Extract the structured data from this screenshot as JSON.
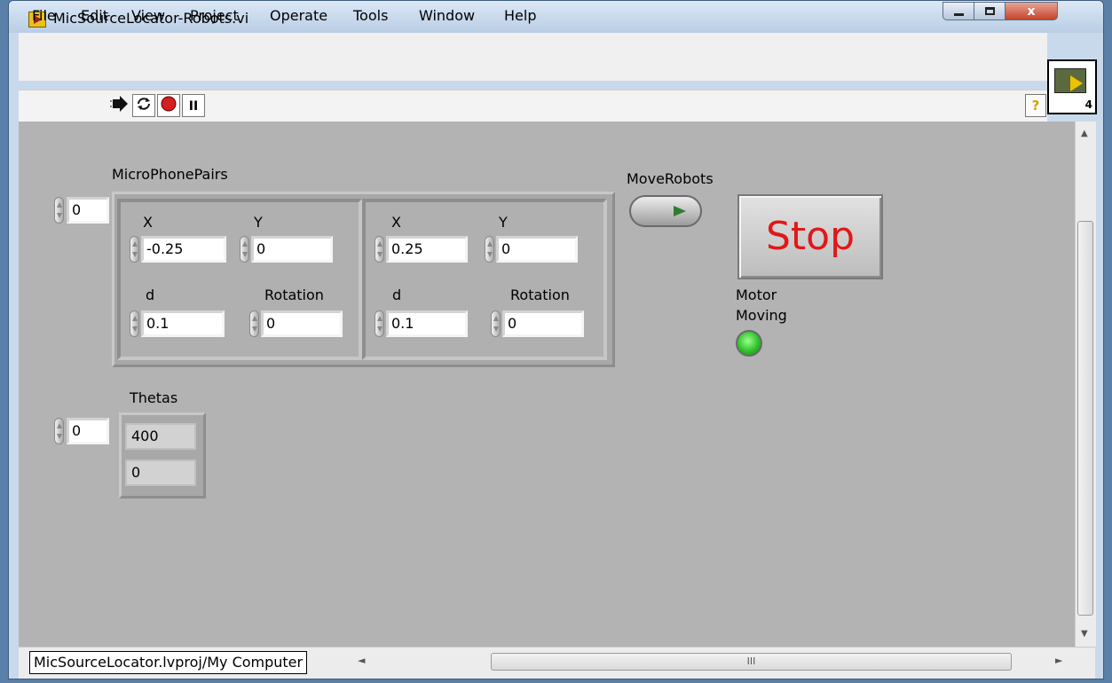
{
  "window": {
    "title": "MicSourceLocator-Robots.vi",
    "close_glyph": "x"
  },
  "menu": [
    "File",
    "Edit",
    "View",
    "Project",
    "Operate",
    "Tools",
    "Window",
    "Help"
  ],
  "toolbar": {
    "run_icon": "run-arrow-icon",
    "continuous_icon": "run-continuously-icon",
    "abort_icon": "abort-icon",
    "pause_icon": "pause-icon",
    "pause_glyph": "II",
    "help_glyph": "?",
    "connector_number": "4"
  },
  "panel": {
    "mic_pairs": {
      "label": "MicroPhonePairs",
      "index": "0",
      "elements": [
        {
          "x_label": "X",
          "x": "-0.25",
          "y_label": "Y",
          "y": "0",
          "d_label": "d",
          "d": "0.1",
          "rot_label": "Rotation",
          "rotation": "0"
        },
        {
          "x_label": "X",
          "x": "0.25",
          "y_label": "Y",
          "y": "0",
          "d_label": "d",
          "d": "0.1",
          "rot_label": "Rotation",
          "rotation": "0"
        }
      ]
    },
    "thetas": {
      "label": "Thetas",
      "index": "0",
      "values": [
        "400",
        "0"
      ]
    },
    "move_robots": {
      "label": "MoveRobots",
      "state": false
    },
    "stop": {
      "label": "Stop",
      "color": "#e01818"
    },
    "motor_moving": {
      "label_line1": "Motor",
      "label_line2": "Moving",
      "state": true,
      "color": "#2fc22a"
    }
  },
  "status_bar": {
    "project_path": "MicSourceLocator.lvproj/My Computer",
    "scroll_grip": "III"
  }
}
